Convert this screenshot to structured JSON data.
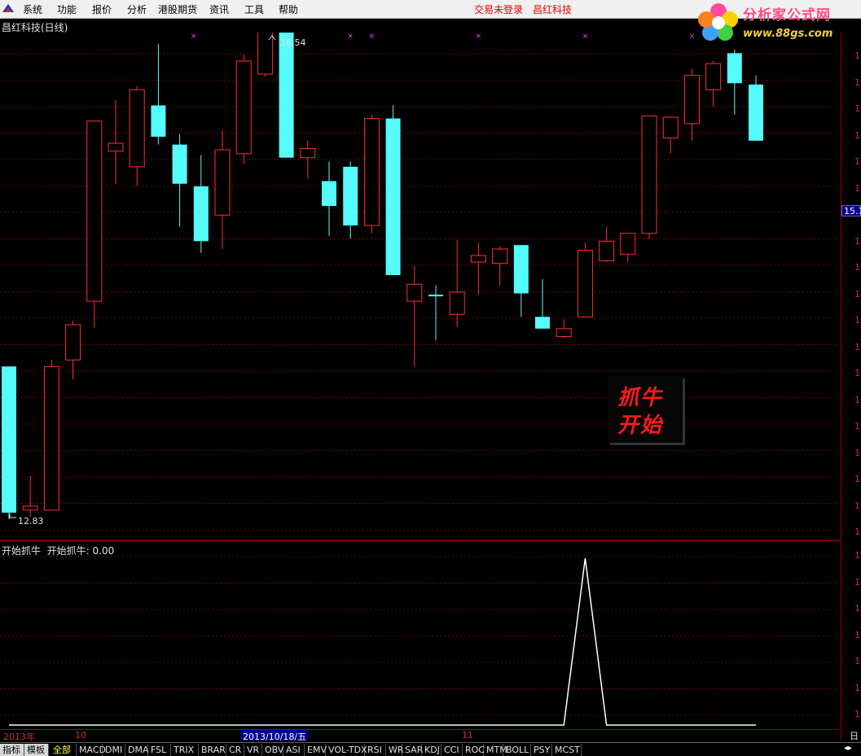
{
  "menu": {
    "items": [
      "系统",
      "功能",
      "报价",
      "分析",
      "港股期货",
      "资讯",
      "工具",
      "帮助"
    ],
    "status_login": "交易未登录",
    "status_stock": "昌红科技"
  },
  "logo": {
    "text": "分析家公式网",
    "url": "www.88gs.com"
  },
  "chart": {
    "title": "昌红科技(日线)",
    "high_label": "16.54",
    "low_label": "12.83",
    "current_price": "15.1",
    "right_axis_digit": "1",
    "annotation": [
      "抓牛",
      "开始"
    ]
  },
  "chart_data": {
    "type": "candlestick",
    "high_marker": 16.54,
    "low_marker": 12.83,
    "candles": [
      {
        "o": 14.0,
        "h": 14.0,
        "l": 12.83,
        "c": 12.88,
        "up": false
      },
      {
        "o": 12.9,
        "h": 13.16,
        "l": 12.85,
        "c": 12.93,
        "up": true
      },
      {
        "o": 12.9,
        "h": 14.05,
        "l": 12.9,
        "c": 14.0,
        "up": true
      },
      {
        "o": 14.05,
        "h": 14.35,
        "l": 13.9,
        "c": 14.32,
        "up": true
      },
      {
        "o": 14.5,
        "h": 15.85,
        "l": 14.3,
        "c": 15.88,
        "up": true
      },
      {
        "o": 15.65,
        "h": 16.04,
        "l": 15.4,
        "c": 15.71,
        "up": true
      },
      {
        "o": 15.53,
        "h": 16.15,
        "l": 15.38,
        "c": 16.12,
        "up": true
      },
      {
        "o": 16.0,
        "h": 16.47,
        "l": 15.7,
        "c": 15.76,
        "up": false
      },
      {
        "o": 15.7,
        "h": 15.78,
        "l": 15.07,
        "c": 15.4,
        "up": false
      },
      {
        "o": 15.38,
        "h": 15.62,
        "l": 14.87,
        "c": 14.96,
        "up": false
      },
      {
        "o": 15.16,
        "h": 15.81,
        "l": 14.9,
        "c": 15.66,
        "up": true
      },
      {
        "o": 15.63,
        "h": 16.39,
        "l": 15.55,
        "c": 16.34,
        "up": true
      },
      {
        "o": 16.24,
        "h": 16.54,
        "l": 16.22,
        "c": 16.61,
        "up": true
      },
      {
        "o": 16.57,
        "h": 16.8,
        "l": 15.6,
        "c": 15.6,
        "up": false
      },
      {
        "o": 15.6,
        "h": 15.73,
        "l": 15.44,
        "c": 15.67,
        "up": true
      },
      {
        "o": 15.42,
        "h": 15.57,
        "l": 15.0,
        "c": 15.23,
        "up": false
      },
      {
        "o": 15.53,
        "h": 15.57,
        "l": 14.98,
        "c": 15.08,
        "up": false
      },
      {
        "o": 15.08,
        "h": 15.93,
        "l": 15.02,
        "c": 15.9,
        "up": true
      },
      {
        "o": 15.9,
        "h": 16.0,
        "l": 14.8,
        "c": 14.7,
        "up": false
      },
      {
        "o": 14.63,
        "h": 14.77,
        "l": 14.0,
        "c": 14.5,
        "up": true
      },
      {
        "o": 14.54,
        "h": 14.62,
        "l": 14.2,
        "c": 14.55,
        "up": false
      },
      {
        "o": 14.4,
        "h": 14.97,
        "l": 14.3,
        "c": 14.57,
        "up": true
      },
      {
        "o": 14.8,
        "h": 14.95,
        "l": 14.55,
        "c": 14.85,
        "up": true
      },
      {
        "o": 14.79,
        "h": 14.92,
        "l": 14.62,
        "c": 14.9,
        "up": true
      },
      {
        "o": 14.93,
        "h": 14.93,
        "l": 14.38,
        "c": 14.56,
        "up": false
      },
      {
        "o": 14.38,
        "h": 14.67,
        "l": 14.34,
        "c": 14.29,
        "up": false
      },
      {
        "o": 14.29,
        "h": 14.36,
        "l": 14.22,
        "c": 14.23,
        "up": true
      },
      {
        "o": 14.38,
        "h": 14.95,
        "l": 14.38,
        "c": 14.89,
        "up": true
      },
      {
        "o": 14.81,
        "h": 15.07,
        "l": 14.8,
        "c": 14.96,
        "up": true
      },
      {
        "o": 14.86,
        "h": 14.97,
        "l": 14.8,
        "c": 15.02,
        "up": true
      },
      {
        "o": 15.02,
        "h": 15.92,
        "l": 14.98,
        "c": 15.92,
        "up": true
      },
      {
        "o": 15.75,
        "h": 15.9,
        "l": 15.63,
        "c": 15.91,
        "up": true
      },
      {
        "o": 15.86,
        "h": 16.28,
        "l": 15.73,
        "c": 16.23,
        "up": true
      },
      {
        "o": 16.12,
        "h": 16.34,
        "l": 15.99,
        "c": 16.32,
        "up": true
      },
      {
        "o": 16.4,
        "h": 16.43,
        "l": 15.93,
        "c": 16.17,
        "up": false
      },
      {
        "o": 16.16,
        "h": 16.23,
        "l": 15.8,
        "c": 15.73,
        "up": false
      }
    ],
    "indicator": {
      "name": "开始抓牛",
      "label": "开始抓牛: 0.00",
      "values": [
        0,
        0,
        0,
        0,
        0,
        0,
        0,
        0,
        0,
        0,
        0,
        0,
        0,
        0,
        0,
        0,
        0,
        0,
        0,
        0,
        0,
        0,
        0,
        0,
        0,
        0,
        0,
        1,
        0,
        0,
        0,
        0,
        0,
        0,
        0,
        0
      ]
    }
  },
  "date_axis": {
    "labels": [
      "2013年",
      "10",
      "11"
    ],
    "cursor": "2013/10/18/五",
    "day": "日"
  },
  "tabs": {
    "left": [
      "指标",
      "模板"
    ],
    "items": [
      "全部",
      "MACD",
      "DMI",
      "DMA",
      "FSL",
      "TRIX",
      "BRAR",
      "CR",
      "VR",
      "OBV",
      "ASI",
      "EMV",
      "VOL-TDX",
      "RSI",
      "WR",
      "SAR",
      "KDJ",
      "CCI",
      "ROC",
      "MTM",
      "BOLL",
      "PSY",
      "MCST"
    ]
  },
  "colors": {
    "up": "#ff3030",
    "down": "#54fcfc",
    "grid": "#7a0000",
    "marker": "#ff40ff"
  }
}
